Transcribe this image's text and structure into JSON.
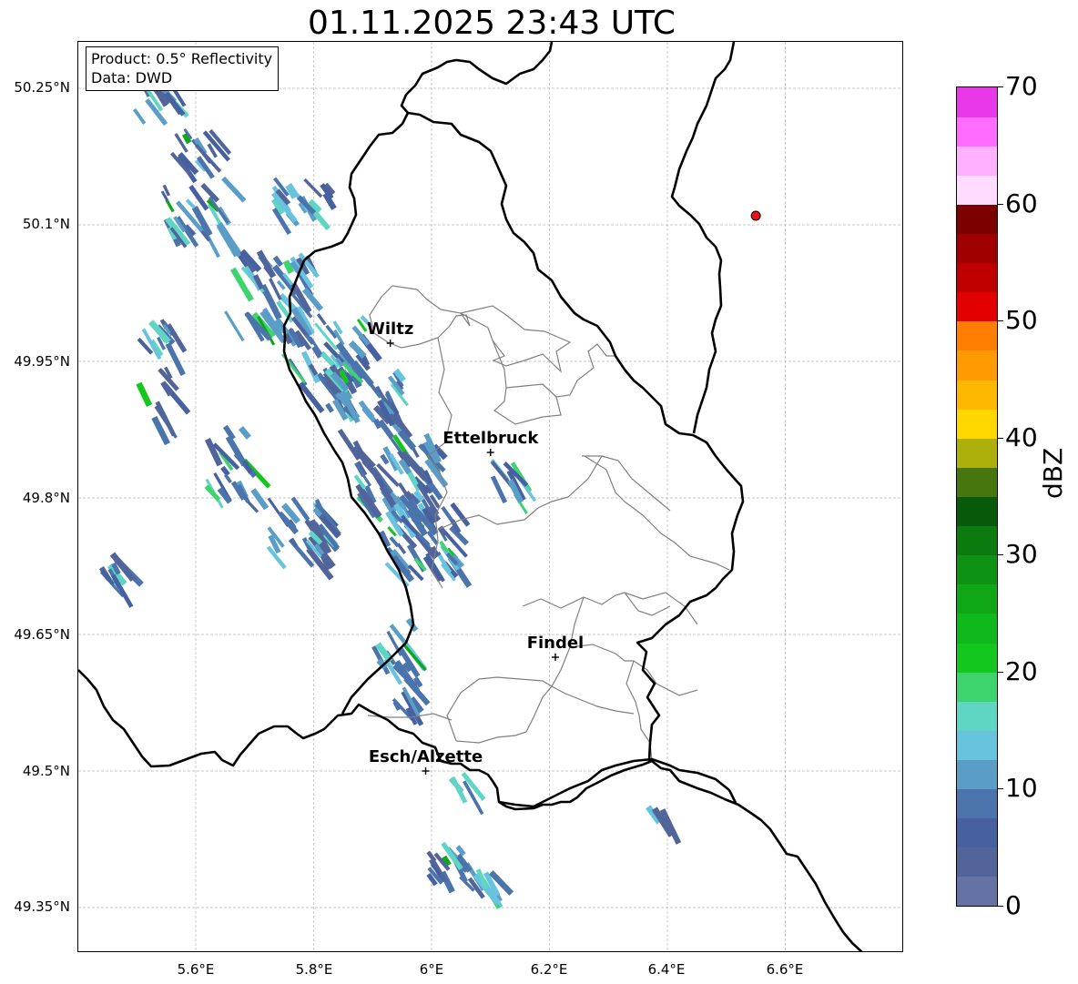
{
  "title": "01.11.2025 23:43 UTC",
  "info": {
    "product": "Product: 0.5° Reflectivity",
    "data": "Data: DWD"
  },
  "axes": {
    "y_ticks": [
      "50.25°N",
      "50.1°N",
      "49.95°N",
      "49.8°N",
      "49.65°N",
      "49.5°N",
      "49.35°N"
    ],
    "x_ticks": [
      "5.6°E",
      "5.8°E",
      "6°E",
      "6.2°E",
      "6.4°E",
      "6.6°E"
    ],
    "lon_range": [
      5.4,
      6.8
    ],
    "lat_range": [
      49.3,
      50.3
    ],
    "grid": true
  },
  "cities": [
    {
      "name": "Wiltz",
      "lon": 5.93,
      "lat": 49.97
    },
    {
      "name": "Ettelbruck",
      "lon": 6.1,
      "lat": 49.85
    },
    {
      "name": "Findel",
      "lon": 6.21,
      "lat": 49.625
    },
    {
      "name": "Esch/Alzette",
      "lon": 5.99,
      "lat": 49.5
    }
  ],
  "radar_site": {
    "lon": 6.55,
    "lat": 50.11,
    "color": "#ee1111"
  },
  "colorbar": {
    "label": "dBZ",
    "ticks": [
      "0",
      "10",
      "20",
      "30",
      "40",
      "50",
      "60",
      "70"
    ],
    "range": [
      0,
      70
    ],
    "colors": [
      "#6472a4",
      "#51659a",
      "#4660a0",
      "#4a74ab",
      "#5a9ec8",
      "#68c3df",
      "#5fd6c3",
      "#3dd46e",
      "#13c71e",
      "#10b91b",
      "#0fa716",
      "#0d9213",
      "#0b7b10",
      "#085a0b",
      "#47750e",
      "#adb00b",
      "#ffd800",
      "#feb800",
      "#ff9b00",
      "#ff7d00",
      "#e30000",
      "#c00000",
      "#a00000",
      "#7c0000",
      "#ffdcff",
      "#ffb1ff",
      "#ff6cff",
      "#e838e8"
    ]
  }
}
